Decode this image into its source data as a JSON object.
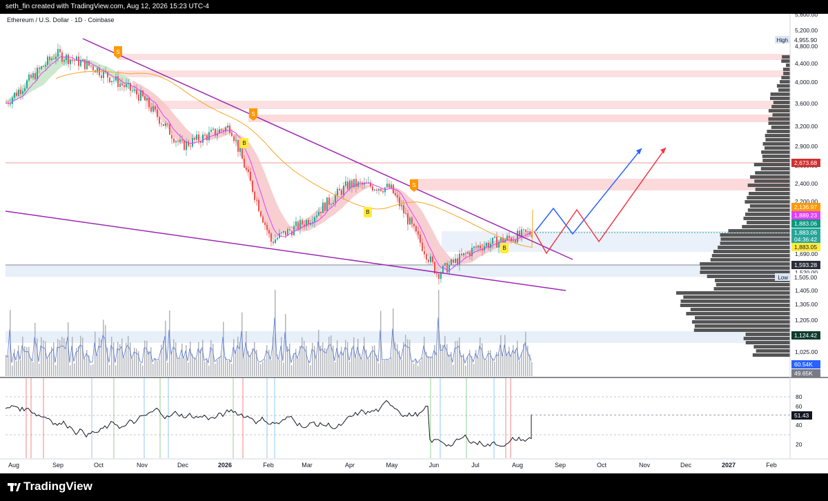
{
  "header": {
    "credit": "seth_fin created with TradingView.com, Aug 12, 2026 15:23 UTC-4"
  },
  "symbol_line": "Ethereum / U.S. Dollar · 1D · Coinbase",
  "footer": {
    "brand": "TradingView"
  },
  "colors": {
    "up": "#26a69a",
    "down": "#ef5350",
    "trendline": "#9c27b0",
    "ma_orange": "#f5a623",
    "ma_pink": "#e040fb",
    "path_blue": "#2962ff",
    "path_red": "#f23645",
    "zone_red": "#fbd1d3",
    "zone_blue": "#dde8f7",
    "profile": "#555555"
  },
  "price_axis": {
    "ticks": [
      "5,600.00",
      "5,200.00",
      "4,800.00",
      "4,400.00",
      "4,000.00",
      "3,600.00",
      "3,200.00",
      "2,900.00",
      "2,600.00",
      "2,400.00",
      "2,200.00",
      "1,690.00",
      "1,520.00",
      "1,405.00",
      "1,305.00",
      "1,205.00",
      "1,025.00"
    ],
    "labels": [
      {
        "id": "high",
        "tag": "High",
        "value": "4,955.90",
        "bg": "#ffffff",
        "fg": "#131722"
      },
      {
        "id": "r1",
        "value": "2,673.68",
        "bg": "#d32f2f",
        "fg": "#ffffff"
      },
      {
        "id": "ma200",
        "value": "2,136.97",
        "bg": "#ff9800",
        "fg": "#ffffff"
      },
      {
        "id": "ma20",
        "value": "1,889.23",
        "bg": "#e040fb",
        "fg": "#ffffff"
      },
      {
        "id": "ema",
        "value": "1,883.06",
        "bg": "#089981",
        "fg": "#ffffff"
      },
      {
        "id": "last",
        "value": "1,883.06",
        "bg": "#26a69a",
        "fg": "#ffffff"
      },
      {
        "id": "countdown",
        "value": "04:36:42",
        "bg": "#26a69a",
        "fg": "#ffffff"
      },
      {
        "id": "poc",
        "value": "1,883.05",
        "bg": "#ffeb3b",
        "fg": "#131722"
      },
      {
        "id": "support",
        "value": "1,593.28",
        "bg": "#2a2e39",
        "fg": "#ffffff"
      },
      {
        "id": "low",
        "tag": "Low",
        "value": "1,505.00",
        "bg": "#ffffff",
        "fg": "#131722"
      },
      {
        "id": "vpoc",
        "value": "1,124.42",
        "bg": "#0d3b2e",
        "fg": "#ffffff"
      },
      {
        "id": "vol1",
        "value": "60.54K",
        "bg": "#2962ff",
        "fg": "#ffffff"
      },
      {
        "id": "vol2",
        "value": "49.65K",
        "bg": "#787b86",
        "fg": "#ffffff"
      }
    ]
  },
  "rsi_axis": {
    "ticks": [
      "80",
      "60",
      "40",
      "20"
    ],
    "current": "51.43"
  },
  "time_axis": {
    "labels": [
      "Aug",
      "Sep",
      "Oct",
      "Nov",
      "Dec",
      "2026",
      "Feb",
      "Mar",
      "Apr",
      "May",
      "Jun",
      "Jul",
      "Aug",
      "Sep",
      "Oct",
      "Nov",
      "Dec",
      "2027",
      "Feb"
    ]
  },
  "signals": [
    {
      "type": "S",
      "label": "S"
    },
    {
      "type": "S",
      "label": "S"
    },
    {
      "type": "S",
      "label": "S"
    },
    {
      "type": "B",
      "label": "B"
    },
    {
      "type": "B",
      "label": "B"
    },
    {
      "type": "B",
      "label": "B"
    }
  ],
  "chart_data": [
    {
      "type": "line",
      "title": "Ethereum / U.S. Dollar · 1D · Coinbase",
      "xlabel": "",
      "ylabel": "",
      "log_scale": true,
      "ylim": [
        1000,
        5600
      ],
      "x": [
        "Aug",
        "Sep",
        "Oct",
        "Nov",
        "Dec",
        "2026",
        "Feb",
        "Mar",
        "Apr",
        "May",
        "Jun",
        "Jul",
        "Aug"
      ],
      "series": [
        {
          "values": [
            3600,
            4600,
            4300,
            3700,
            2900,
            3200,
            1800,
            2000,
            2400,
            2350,
            1530,
            1750,
            1883
          ]
        }
      ],
      "projection_blue": [
        1883,
        2136,
        1883,
        3000
      ],
      "projection_red": [
        1883,
        1650,
        2136,
        1750,
        2900
      ],
      "levels": [
        4955.9,
        2673.68,
        2136.97,
        1889.23,
        1883.06,
        1593.28,
        1505.0,
        1124.42
      ],
      "grid": false
    },
    {
      "type": "bar",
      "title": "",
      "volume_labels": [
        "60.54K",
        "49.65K"
      ]
    },
    {
      "type": "line",
      "title": "",
      "ylim": [
        10,
        90
      ],
      "levels": [
        70,
        50,
        30
      ],
      "current": 51.43
    }
  ]
}
